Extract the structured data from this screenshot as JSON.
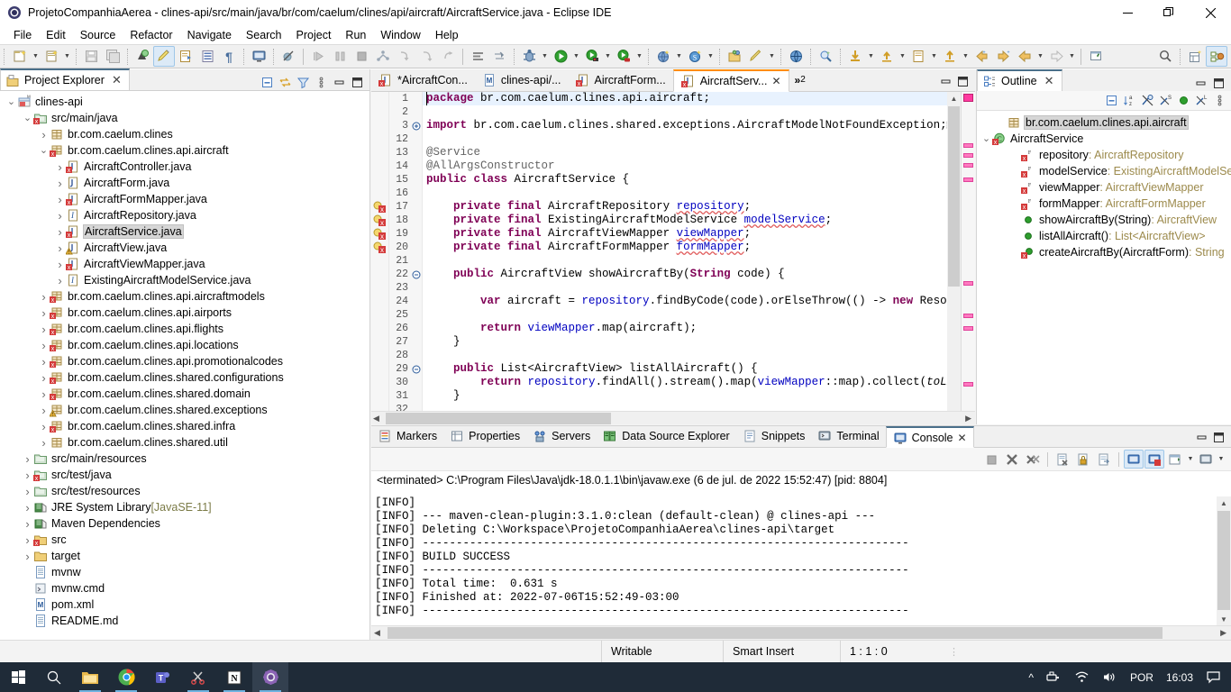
{
  "window": {
    "title": "ProjetoCompanhiaAerea - clines-api/src/main/java/br/com/caelum/clines/api/aircraft/AircraftService.java - Eclipse IDE",
    "minimize": "—",
    "maximize": "❐",
    "close": "✕"
  },
  "menu": [
    "File",
    "Edit",
    "Source",
    "Refactor",
    "Navigate",
    "Search",
    "Project",
    "Run",
    "Window",
    "Help"
  ],
  "project_explorer": {
    "tab_label": "Project Explorer",
    "close": "✕",
    "toolbar": [
      "collapse-all-icon",
      "link-with-editor-icon",
      "view-menu-filter-icon",
      "view-menu-icon",
      "minimize-icon",
      "maximize-icon"
    ],
    "tree": [
      {
        "label": "clines-api",
        "indent": 0,
        "chev": "v",
        "icon": "maven-project",
        "selected": false
      },
      {
        "label": "src/main/java",
        "indent": 1,
        "chev": "v",
        "icon": "source-folder",
        "selected": false
      },
      {
        "label": "br.com.caelum.clines",
        "indent": 2,
        "chev": ">",
        "icon": "package",
        "selected": false
      },
      {
        "label": "br.com.caelum.clines.api.aircraft",
        "indent": 2,
        "chev": "v",
        "icon": "package-err",
        "selected": false
      },
      {
        "label": "AircraftController.java",
        "indent": 3,
        "chev": ">",
        "icon": "java-err",
        "selected": false
      },
      {
        "label": "AircraftForm.java",
        "indent": 3,
        "chev": ">",
        "icon": "java",
        "selected": false
      },
      {
        "label": "AircraftFormMapper.java",
        "indent": 3,
        "chev": ">",
        "icon": "java-err",
        "selected": false
      },
      {
        "label": "AircraftRepository.java",
        "indent": 3,
        "chev": ">",
        "icon": "java-iface",
        "selected": false
      },
      {
        "label": "AircraftService.java",
        "indent": 3,
        "chev": ">",
        "icon": "java-err",
        "selected": true
      },
      {
        "label": "AircraftView.java",
        "indent": 3,
        "chev": ">",
        "icon": "java-warn",
        "selected": false
      },
      {
        "label": "AircraftViewMapper.java",
        "indent": 3,
        "chev": ">",
        "icon": "java-err",
        "selected": false
      },
      {
        "label": "ExistingAircraftModelService.java",
        "indent": 3,
        "chev": ">",
        "icon": "java-iface",
        "selected": false
      },
      {
        "label": "br.com.caelum.clines.api.aircraftmodels",
        "indent": 2,
        "chev": ">",
        "icon": "package-err",
        "selected": false
      },
      {
        "label": "br.com.caelum.clines.api.airports",
        "indent": 2,
        "chev": ">",
        "icon": "package-err",
        "selected": false
      },
      {
        "label": "br.com.caelum.clines.api.flights",
        "indent": 2,
        "chev": ">",
        "icon": "package-err",
        "selected": false
      },
      {
        "label": "br.com.caelum.clines.api.locations",
        "indent": 2,
        "chev": ">",
        "icon": "package-err",
        "selected": false
      },
      {
        "label": "br.com.caelum.clines.api.promotionalcodes",
        "indent": 2,
        "chev": ">",
        "icon": "package-err",
        "selected": false
      },
      {
        "label": "br.com.caelum.clines.shared.configurations",
        "indent": 2,
        "chev": ">",
        "icon": "package-err",
        "selected": false
      },
      {
        "label": "br.com.caelum.clines.shared.domain",
        "indent": 2,
        "chev": ">",
        "icon": "package-err",
        "selected": false
      },
      {
        "label": "br.com.caelum.clines.shared.exceptions",
        "indent": 2,
        "chev": ">",
        "icon": "package-warn",
        "selected": false
      },
      {
        "label": "br.com.caelum.clines.shared.infra",
        "indent": 2,
        "chev": ">",
        "icon": "package-err",
        "selected": false
      },
      {
        "label": "br.com.caelum.clines.shared.util",
        "indent": 2,
        "chev": ">",
        "icon": "package",
        "selected": false
      },
      {
        "label": "src/main/resources",
        "indent": 1,
        "chev": ">",
        "icon": "source-folder-plain",
        "selected": false
      },
      {
        "label": "src/test/java",
        "indent": 1,
        "chev": ">",
        "icon": "source-folder",
        "selected": false
      },
      {
        "label": "src/test/resources",
        "indent": 1,
        "chev": ">",
        "icon": "source-folder-plain",
        "selected": false
      },
      {
        "label": "JRE System Library",
        "suffix": "[JavaSE-11]",
        "indent": 1,
        "chev": ">",
        "icon": "library",
        "selected": false
      },
      {
        "label": "Maven Dependencies",
        "indent": 1,
        "chev": ">",
        "icon": "library",
        "selected": false
      },
      {
        "label": "src",
        "indent": 1,
        "chev": ">",
        "icon": "folder-err",
        "selected": false
      },
      {
        "label": "target",
        "indent": 1,
        "chev": ">",
        "icon": "folder",
        "selected": false
      },
      {
        "label": "mvnw",
        "indent": 1,
        "chev": "",
        "icon": "file",
        "selected": false
      },
      {
        "label": "mvnw.cmd",
        "indent": 1,
        "chev": "",
        "icon": "file-cmd",
        "selected": false
      },
      {
        "label": "pom.xml",
        "indent": 1,
        "chev": "",
        "icon": "file-maven",
        "selected": false
      },
      {
        "label": "README.md",
        "indent": 1,
        "chev": "",
        "icon": "file",
        "selected": false
      }
    ]
  },
  "editor": {
    "tabs": [
      {
        "label": "*AircraftCon...",
        "icon": "java-err",
        "active": false
      },
      {
        "label": "clines-api/...",
        "icon": "file-maven",
        "active": false
      },
      {
        "label": "AircraftForm...",
        "icon": "java-err",
        "active": false
      },
      {
        "label": "AircraftServ...",
        "icon": "java-err",
        "active": true
      }
    ],
    "overflow_label": "»",
    "overflow_count": "2",
    "close": "✕",
    "minimize": "—",
    "maximize": "❐",
    "lines": [
      {
        "num": "1",
        "marker": "",
        "fold": "",
        "current": true,
        "tokens": [
          {
            "t": "package",
            "c": "kw"
          },
          {
            "t": " br.com.caelum.clines.api.aircraft;",
            "c": ""
          }
        ]
      },
      {
        "num": "2",
        "marker": "",
        "fold": "",
        "current": false,
        "tokens": []
      },
      {
        "num": "3",
        "marker": "",
        "fold": "+",
        "current": false,
        "tokens": [
          {
            "t": "import",
            "c": "kw"
          },
          {
            "t": " br.com.caelum.clines.shared.exceptions.AircraftModelNotFoundException;",
            "c": ""
          },
          {
            "t": "⬚",
            "c": "ann"
          }
        ]
      },
      {
        "num": "12",
        "marker": "",
        "fold": "",
        "current": false,
        "tokens": []
      },
      {
        "num": "13",
        "marker": "",
        "fold": "",
        "current": false,
        "tokens": [
          {
            "t": "@Service",
            "c": "ann"
          }
        ]
      },
      {
        "num": "14",
        "marker": "",
        "fold": "",
        "current": false,
        "tokens": [
          {
            "t": "@AllArgsConstructor",
            "c": "ann"
          }
        ]
      },
      {
        "num": "15",
        "marker": "",
        "fold": "",
        "current": false,
        "tokens": [
          {
            "t": "public class",
            "c": "kw"
          },
          {
            "t": " AircraftService {",
            "c": ""
          }
        ]
      },
      {
        "num": "16",
        "marker": "",
        "fold": "",
        "current": false,
        "tokens": []
      },
      {
        "num": "17",
        "marker": "err",
        "fold": "",
        "current": false,
        "tokens": [
          {
            "t": "    ",
            "c": ""
          },
          {
            "t": "private final",
            "c": "kw"
          },
          {
            "t": " AircraftRepository ",
            "c": ""
          },
          {
            "t": "repository",
            "c": "fld undl"
          },
          {
            "t": ";",
            "c": ""
          }
        ]
      },
      {
        "num": "18",
        "marker": "err",
        "fold": "",
        "current": false,
        "tokens": [
          {
            "t": "    ",
            "c": ""
          },
          {
            "t": "private final",
            "c": "kw"
          },
          {
            "t": " ExistingAircraftModelService ",
            "c": ""
          },
          {
            "t": "modelService",
            "c": "fld undl"
          },
          {
            "t": ";",
            "c": ""
          }
        ]
      },
      {
        "num": "19",
        "marker": "err",
        "fold": "",
        "current": false,
        "tokens": [
          {
            "t": "    ",
            "c": ""
          },
          {
            "t": "private final",
            "c": "kw"
          },
          {
            "t": " AircraftViewMapper ",
            "c": ""
          },
          {
            "t": "viewMapper",
            "c": "fld undl"
          },
          {
            "t": ";",
            "c": ""
          }
        ]
      },
      {
        "num": "20",
        "marker": "err",
        "fold": "",
        "current": false,
        "tokens": [
          {
            "t": "    ",
            "c": ""
          },
          {
            "t": "private final",
            "c": "kw"
          },
          {
            "t": " AircraftFormMapper ",
            "c": ""
          },
          {
            "t": "formMapper",
            "c": "fld undl"
          },
          {
            "t": ";",
            "c": ""
          }
        ]
      },
      {
        "num": "21",
        "marker": "",
        "fold": "",
        "current": false,
        "tokens": []
      },
      {
        "num": "22",
        "marker": "",
        "fold": "-",
        "current": false,
        "tokens": [
          {
            "t": "    ",
            "c": ""
          },
          {
            "t": "public",
            "c": "kw"
          },
          {
            "t": " AircraftView showAircraftBy(",
            "c": ""
          },
          {
            "t": "String",
            "c": "kw"
          },
          {
            "t": " code) {",
            "c": ""
          }
        ]
      },
      {
        "num": "23",
        "marker": "",
        "fold": "",
        "current": false,
        "tokens": []
      },
      {
        "num": "24",
        "marker": "",
        "fold": "",
        "current": false,
        "tokens": [
          {
            "t": "        ",
            "c": ""
          },
          {
            "t": "var",
            "c": "kw"
          },
          {
            "t": " aircraft = ",
            "c": ""
          },
          {
            "t": "repository",
            "c": "fld"
          },
          {
            "t": ".findByCode(code).orElseThrow(() -> ",
            "c": ""
          },
          {
            "t": "new",
            "c": "kw"
          },
          {
            "t": " ResourceNotF",
            "c": ""
          }
        ]
      },
      {
        "num": "25",
        "marker": "",
        "fold": "",
        "current": false,
        "tokens": []
      },
      {
        "num": "26",
        "marker": "",
        "fold": "",
        "current": false,
        "tokens": [
          {
            "t": "        ",
            "c": ""
          },
          {
            "t": "return",
            "c": "kw"
          },
          {
            "t": " ",
            "c": ""
          },
          {
            "t": "viewMapper",
            "c": "fld"
          },
          {
            "t": ".map(aircraft);",
            "c": ""
          }
        ]
      },
      {
        "num": "27",
        "marker": "",
        "fold": "",
        "current": false,
        "tokens": [
          {
            "t": "    }",
            "c": ""
          }
        ]
      },
      {
        "num": "28",
        "marker": "",
        "fold": "",
        "current": false,
        "tokens": []
      },
      {
        "num": "29",
        "marker": "",
        "fold": "-",
        "current": false,
        "tokens": [
          {
            "t": "    ",
            "c": ""
          },
          {
            "t": "public",
            "c": "kw"
          },
          {
            "t": " List<AircraftView> listAllAircraft() {",
            "c": ""
          }
        ]
      },
      {
        "num": "30",
        "marker": "",
        "fold": "",
        "current": false,
        "tokens": [
          {
            "t": "        ",
            "c": ""
          },
          {
            "t": "return",
            "c": "kw"
          },
          {
            "t": " ",
            "c": ""
          },
          {
            "t": "repository",
            "c": "fld"
          },
          {
            "t": ".findAll().stream().map(",
            "c": ""
          },
          {
            "t": "viewMapper",
            "c": "fld"
          },
          {
            "t": "::map).collect(",
            "c": ""
          },
          {
            "t": "toList",
            "c": "ital"
          },
          {
            "t": "());",
            "c": ""
          }
        ]
      },
      {
        "num": "31",
        "marker": "",
        "fold": "",
        "current": false,
        "tokens": [
          {
            "t": "    }",
            "c": ""
          }
        ]
      },
      {
        "num": "32",
        "marker": "",
        "fold": "",
        "current": false,
        "tokens": []
      }
    ]
  },
  "outline": {
    "tab_label": "Outline",
    "close": "✕",
    "toolbar": [
      "collapse-all-icon",
      "sort-icon",
      "hide-fields-icon",
      "hide-static-icon",
      "hide-nonpublic-icon",
      "hide-local-icon",
      "view-menu-icon"
    ],
    "items": [
      {
        "label": "br.com.caelum.clines.api.aircraft",
        "type": "",
        "indent": 1,
        "chev": "",
        "icon": "package",
        "selected": true
      },
      {
        "label": "AircraftService",
        "type": "",
        "indent": 0,
        "chev": "v",
        "icon": "class-err",
        "selected": false
      },
      {
        "label": "repository",
        "type": " : AircraftRepository",
        "indent": 2,
        "chev": "",
        "icon": "field-err",
        "selected": false
      },
      {
        "label": "modelService",
        "type": " : ExistingAircraftModelServ",
        "indent": 2,
        "chev": "",
        "icon": "field-err",
        "selected": false
      },
      {
        "label": "viewMapper",
        "type": " : AircraftViewMapper",
        "indent": 2,
        "chev": "",
        "icon": "field-err",
        "selected": false
      },
      {
        "label": "formMapper",
        "type": " : AircraftFormMapper",
        "indent": 2,
        "chev": "",
        "icon": "field-err",
        "selected": false
      },
      {
        "label": "showAircraftBy(String)",
        "type": " : AircraftView",
        "indent": 2,
        "chev": "",
        "icon": "method",
        "selected": false
      },
      {
        "label": "listAllAircraft()",
        "type": " : List<AircraftView>",
        "indent": 2,
        "chev": "",
        "icon": "method",
        "selected": false
      },
      {
        "label": "createAircraftBy(AircraftForm)",
        "type": " : String",
        "indent": 2,
        "chev": "",
        "icon": "method-err",
        "selected": false
      }
    ]
  },
  "console": {
    "tabs": [
      {
        "label": "Markers",
        "icon": "markers-icon",
        "active": false
      },
      {
        "label": "Properties",
        "icon": "properties-icon",
        "active": false
      },
      {
        "label": "Servers",
        "icon": "servers-icon",
        "active": false
      },
      {
        "label": "Data Source Explorer",
        "icon": "datasource-icon",
        "active": false
      },
      {
        "label": "Snippets",
        "icon": "snippets-icon",
        "active": false
      },
      {
        "label": "Terminal",
        "icon": "terminal-icon",
        "active": false
      },
      {
        "label": "Console",
        "icon": "console-icon",
        "active": true
      }
    ],
    "close": "✕",
    "minimize": "—",
    "maximize": "❐",
    "toolbar": [
      "terminate-icon",
      "remove-launch-icon",
      "remove-all-launches-icon",
      "clear-console-icon",
      "scroll-lock-icon",
      "word-wrap-icon",
      "pin-console-icon",
      "display-selected-console-icon",
      "open-console-icon",
      "new-console-view-icon"
    ],
    "header": "<terminated> C:\\Program Files\\Java\\jdk-18.0.1.1\\bin\\javaw.exe (6 de jul. de 2022 15:52:47) [pid: 8804]",
    "output": [
      "[INFO] ",
      "[INFO] --- maven-clean-plugin:3.1.0:clean (default-clean) @ clines-api ---",
      "[INFO] Deleting C:\\Workspace\\ProjetoCompanhiaAerea\\clines-api\\target",
      "[INFO] ------------------------------------------------------------------------",
      "[INFO] BUILD SUCCESS",
      "[INFO] ------------------------------------------------------------------------",
      "[INFO] Total time:  0.631 s",
      "[INFO] Finished at: 2022-07-06T15:52:49-03:00",
      "[INFO] ------------------------------------------------------------------------"
    ]
  },
  "statusbar": {
    "writable": "Writable",
    "insert_mode": "Smart Insert",
    "position": "1 : 1 : 0"
  },
  "taskbar": {
    "items": [
      "windows-start-icon",
      "search-icon",
      "file-explorer-icon",
      "chrome-icon",
      "teams-icon",
      "snipping-tool-icon",
      "notion-icon",
      "eclipse-icon"
    ],
    "tray": {
      "chevron": "^",
      "icons": [
        "network-icon",
        "wifi-icon",
        "volume-icon"
      ],
      "language": "POR",
      "clock": "16:03",
      "notification": "notification-icon"
    }
  },
  "colors": {
    "accent_orange": "#ff8c00",
    "accent_blue": "#4a6f8a",
    "taskbar_bg": "#1f2b38",
    "error_marker": "#ff7ac0",
    "keyword": "#7f0055",
    "field": "#0000c0"
  }
}
